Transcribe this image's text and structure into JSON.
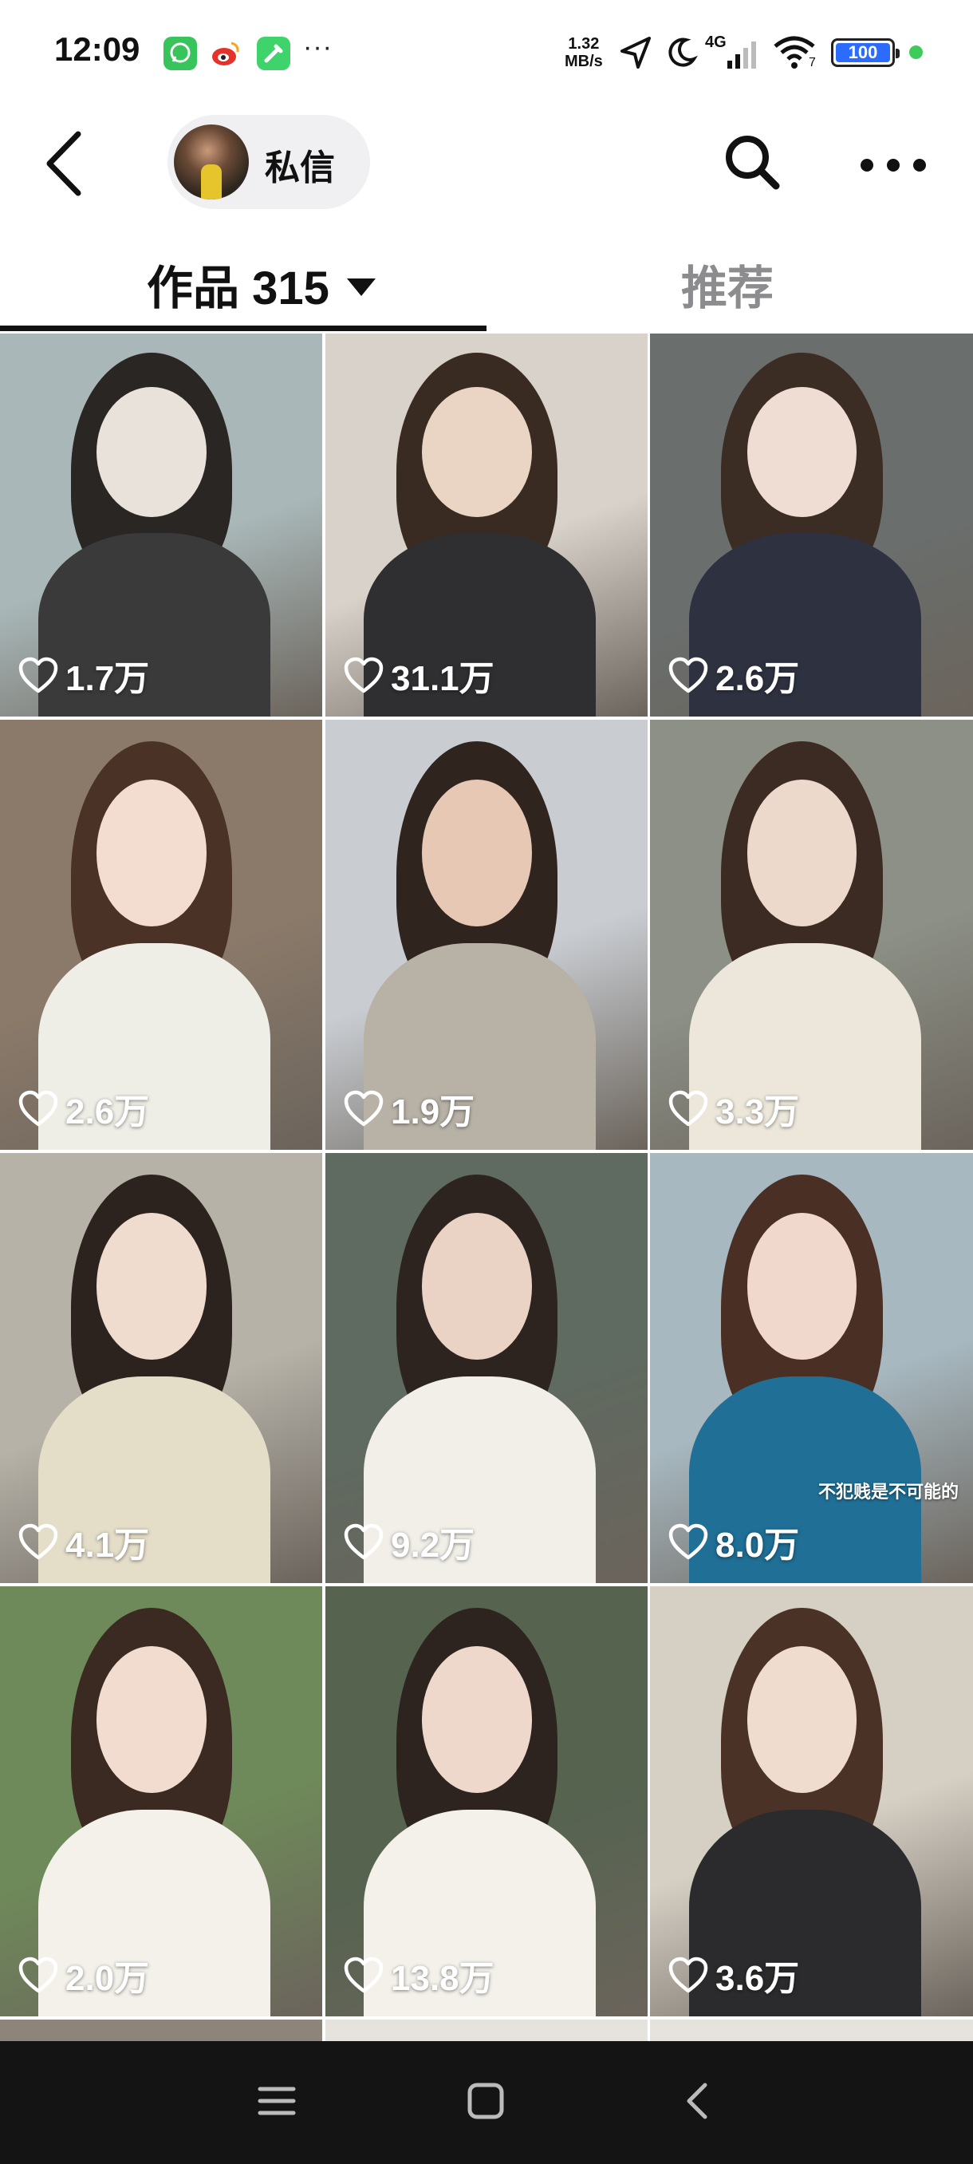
{
  "status_bar": {
    "time": "12:09",
    "overflow": "···",
    "speed_value": "1.32",
    "speed_unit": "MB/s",
    "network": "4G",
    "wifi_badge": "7",
    "battery": "100",
    "icons": [
      "whatsapp-icon",
      "weibo-icon",
      "toolbox-icon",
      "location-icon",
      "moon-icon",
      "signal-icon",
      "wifi-icon",
      "battery-icon"
    ]
  },
  "header": {
    "message_label": "私信",
    "icons": [
      "back-icon",
      "search-icon",
      "more-icon"
    ]
  },
  "tabs": {
    "works_label": "作品",
    "works_count": "315",
    "recommend_label": "推荐"
  },
  "videos": [
    {
      "likes": "1.7万"
    },
    {
      "likes": "31.1万"
    },
    {
      "likes": "2.6万"
    },
    {
      "likes": "2.6万"
    },
    {
      "likes": "1.9万"
    },
    {
      "likes": "3.3万"
    },
    {
      "likes": "4.1万"
    },
    {
      "likes": "9.2万"
    },
    {
      "likes": "8.0万",
      "caption": "不犯贱是不可能的"
    },
    {
      "likes": "2.0万"
    },
    {
      "likes": "13.8万"
    },
    {
      "likes": "3.6万"
    }
  ],
  "colors": {
    "accent_text": "#111111",
    "inactive_tab": "#8c8c8f",
    "battery_fill": "#2b6cff",
    "status_dot": "#3ecb5a"
  }
}
